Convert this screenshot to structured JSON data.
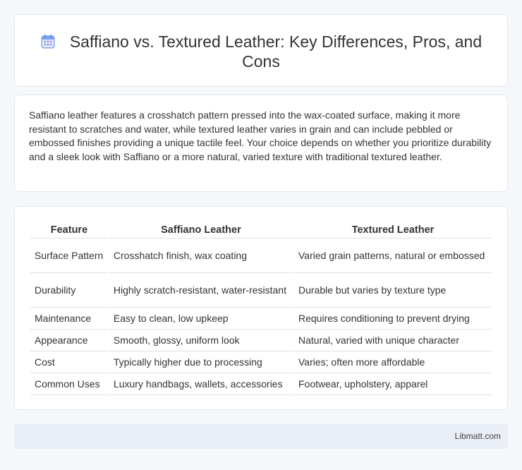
{
  "header": {
    "title": "Saffiano vs. Textured Leather: Key Differences, Pros, and Cons",
    "icon": "calendar-icon",
    "accent_color": "#5b8def"
  },
  "summary": {
    "text": "Saffiano leather features a crosshatch pattern pressed into the wax-coated surface, making it more resistant to scratches and water, while textured leather varies in grain and can include pebbled or embossed finishes providing a unique tactile feel. Your choice depends on whether you prioritize durability and a sleek look with Saffiano or a more natural, varied texture with traditional textured leather."
  },
  "table": {
    "headers": [
      "Feature",
      "Saffiano Leather",
      "Textured Leather"
    ],
    "rows": [
      [
        "Surface Pattern",
        "Crosshatch finish, wax coating",
        "Varied grain patterns, natural or embossed"
      ],
      [
        "Durability",
        "Highly scratch-resistant, water-resistant",
        "Durable but varies by texture type"
      ],
      [
        "Maintenance",
        "Easy to clean, low upkeep",
        "Requires conditioning to prevent drying"
      ],
      [
        "Appearance",
        "Smooth, glossy, uniform look",
        "Natural, varied with unique character"
      ],
      [
        "Cost",
        "Typically higher due to processing",
        "Varies; often more affordable"
      ],
      [
        "Common Uses",
        "Luxury handbags, wallets, accessories",
        "Footwear, upholstery, apparel"
      ]
    ]
  },
  "footer": {
    "text": "Libmatt.com"
  }
}
